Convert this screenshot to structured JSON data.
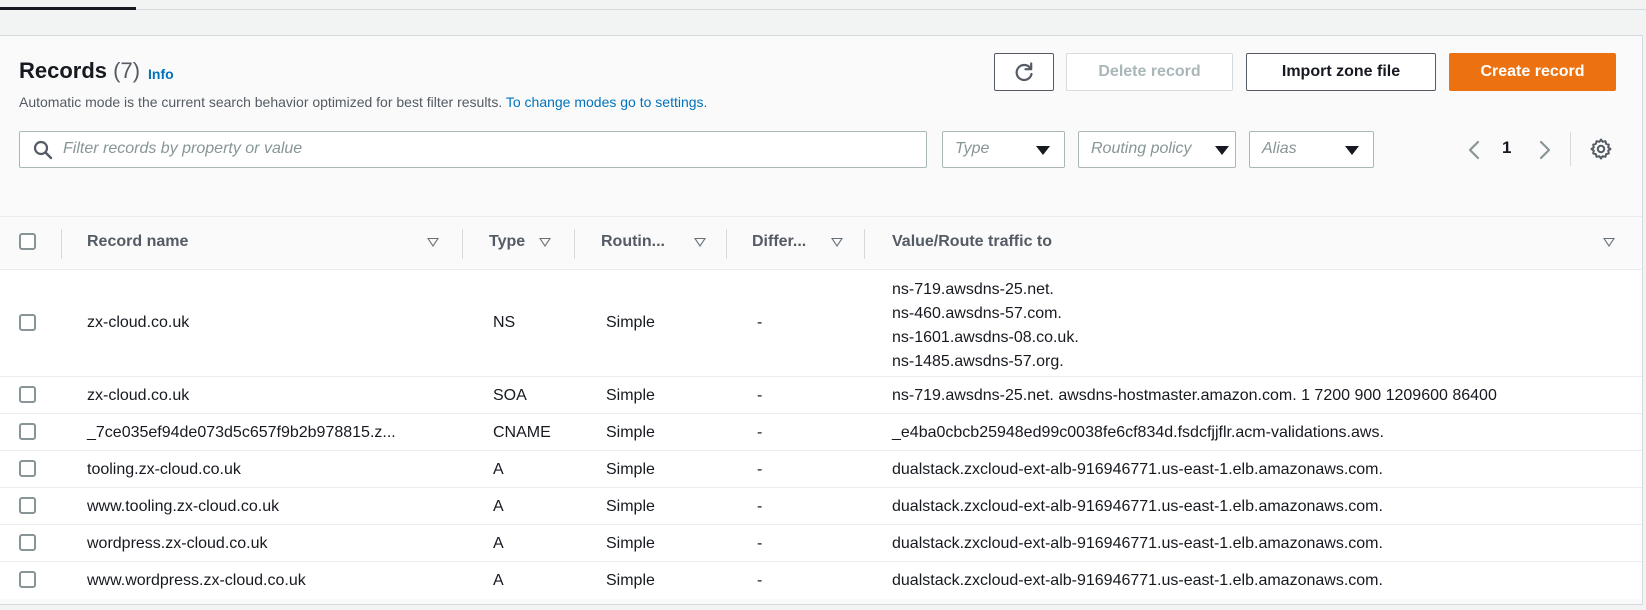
{
  "header": {
    "title": "Records",
    "count": "(7)",
    "info": "Info",
    "description": "Automatic mode is the current search behavior optimized for best filter results.",
    "settings_link": "To change modes go to settings."
  },
  "toolbar": {
    "refresh_icon": "refresh-icon",
    "delete_label": "Delete record",
    "import_label": "Import zone file",
    "create_label": "Create record",
    "create_color": "#ec7211"
  },
  "filters": {
    "search_placeholder": "Filter records by property or value",
    "type_placeholder": "Type",
    "routing_placeholder": "Routing policy",
    "alias_placeholder": "Alias"
  },
  "pagination": {
    "current_page": "1"
  },
  "table": {
    "columns": [
      "Record name",
      "Type",
      "Routin...",
      "Differ...",
      "Value/Route traffic to"
    ],
    "rows": [
      {
        "name": "zx-cloud.co.uk",
        "type": "NS",
        "routing": "Simple",
        "diff": "-",
        "values": [
          "ns-719.awsdns-25.net.",
          "ns-460.awsdns-57.com.",
          "ns-1601.awsdns-08.co.uk.",
          "ns-1485.awsdns-57.org."
        ]
      },
      {
        "name": "zx-cloud.co.uk",
        "type": "SOA",
        "routing": "Simple",
        "diff": "-",
        "values": [
          "ns-719.awsdns-25.net. awsdns-hostmaster.amazon.com. 1 7200 900 1209600 86400"
        ]
      },
      {
        "name": "_7ce035ef94de073d5c657f9b2b978815.z...",
        "type": "CNAME",
        "routing": "Simple",
        "diff": "-",
        "values": [
          "_e4ba0cbcb25948ed99c0038fe6cf834d.fsdcfjjflr.acm-validations.aws."
        ]
      },
      {
        "name": "tooling.zx-cloud.co.uk",
        "type": "A",
        "routing": "Simple",
        "diff": "-",
        "values": [
          "dualstack.zxcloud-ext-alb-916946771.us-east-1.elb.amazonaws.com."
        ]
      },
      {
        "name": "www.tooling.zx-cloud.co.uk",
        "type": "A",
        "routing": "Simple",
        "diff": "-",
        "values": [
          "dualstack.zxcloud-ext-alb-916946771.us-east-1.elb.amazonaws.com."
        ]
      },
      {
        "name": "wordpress.zx-cloud.co.uk",
        "type": "A",
        "routing": "Simple",
        "diff": "-",
        "values": [
          "dualstack.zxcloud-ext-alb-916946771.us-east-1.elb.amazonaws.com."
        ]
      },
      {
        "name": "www.wordpress.zx-cloud.co.uk",
        "type": "A",
        "routing": "Simple",
        "diff": "-",
        "values": [
          "dualstack.zxcloud-ext-alb-916946771.us-east-1.elb.amazonaws.com."
        ]
      }
    ]
  }
}
